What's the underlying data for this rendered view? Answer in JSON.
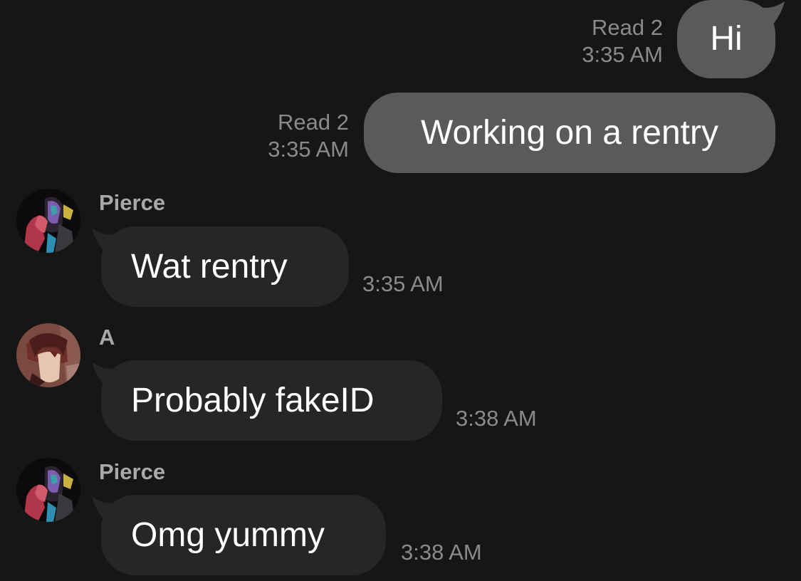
{
  "outgoing": [
    {
      "text": "Hi",
      "status": "Read 2",
      "time": "3:35 AM"
    },
    {
      "text": "Working on a rentry",
      "status": "Read 2",
      "time": "3:35 AM"
    }
  ],
  "incoming": [
    {
      "sender": "Pierce",
      "text": "Wat rentry",
      "time": "3:35 AM",
      "avatar": "avatar-pierce"
    },
    {
      "sender": "A",
      "text": "Probably fakeID",
      "time": "3:38 AM",
      "avatar": "avatar-a"
    },
    {
      "sender": "Pierce",
      "text": "Omg yummy",
      "time": "3:38 AM",
      "avatar": "avatar-pierce"
    }
  ],
  "colors": {
    "background": "#161616",
    "outgoing_bubble": "#5a5a5a",
    "incoming_bubble": "#262626",
    "meta_text": "#8a8a8a",
    "sender_text": "#a9a9a9"
  }
}
